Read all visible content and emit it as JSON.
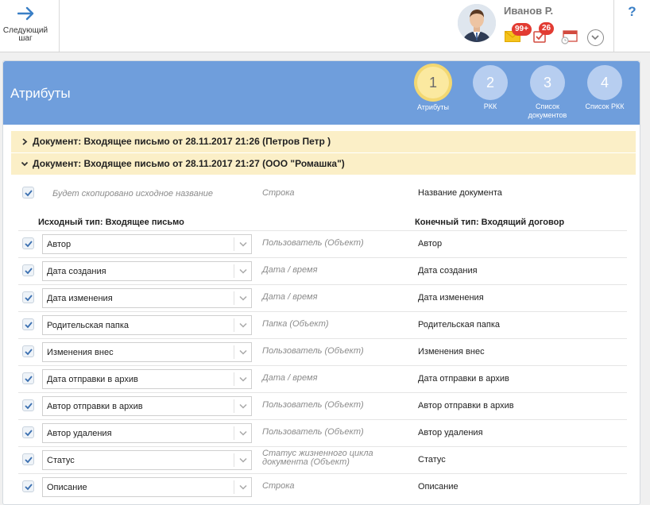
{
  "topbar": {
    "next_step_label": "Следующий шаг",
    "user_name": "Иванов Р.",
    "mail_badge": "99+",
    "task_badge": "26",
    "help": "?"
  },
  "panel": {
    "title": "Атрибуты",
    "steps": [
      {
        "number": "1",
        "label": "Атрибуты",
        "active": true
      },
      {
        "number": "2",
        "label": "РКК",
        "active": false
      },
      {
        "number": "3",
        "label": "Список документов",
        "active": false
      },
      {
        "number": "4",
        "label": "Список РКК",
        "active": false
      }
    ],
    "documents": [
      {
        "label": "Документ: Входящее письмо от 28.11.2017 21:26 (Петров Петр )",
        "expanded": false
      },
      {
        "label": "Документ: Входящее письмо от 28.11.2017 21:27 (ООО \"Ромашка\")",
        "expanded": true
      }
    ],
    "name_row": {
      "source": "Будет скопировано исходное название",
      "type": "Строка",
      "target": "Название документа"
    },
    "source_type_header": "Исходный тип: Входящее письмо",
    "target_type_header": "Конечный тип: Входящий договор",
    "rows": [
      {
        "source": "Автор",
        "type": "Пользователь (Объект)",
        "target": "Автор"
      },
      {
        "source": "Дата создания",
        "type": "Дата / время",
        "target": "Дата создания"
      },
      {
        "source": "Дата изменения",
        "type": "Дата / время",
        "target": "Дата изменения"
      },
      {
        "source": "Родительская папка",
        "type": "Папка (Объект)",
        "target": "Родительская папка"
      },
      {
        "source": "Изменения внес",
        "type": "Пользователь (Объект)",
        "target": "Изменения внес"
      },
      {
        "source": "Дата отправки в архив",
        "type": "Дата / время",
        "target": "Дата отправки в архив"
      },
      {
        "source": "Автор отправки в архив",
        "type": "Пользователь (Объект)",
        "target": "Автор отправки в архив"
      },
      {
        "source": "Автор удаления",
        "type": "Пользователь (Объект)",
        "target": "Автор удаления"
      },
      {
        "source": "Статус",
        "type": "Статус жизненного цикла документа (Объект)",
        "target": "Статус"
      },
      {
        "source": "Описание",
        "type": "Строка",
        "target": "Описание"
      }
    ]
  },
  "colors": {
    "header_blue": "#6f9edc",
    "doc_bar": "#fbefc7",
    "badge_red": "#e23b32",
    "accent_blue": "#3a7fc6"
  }
}
